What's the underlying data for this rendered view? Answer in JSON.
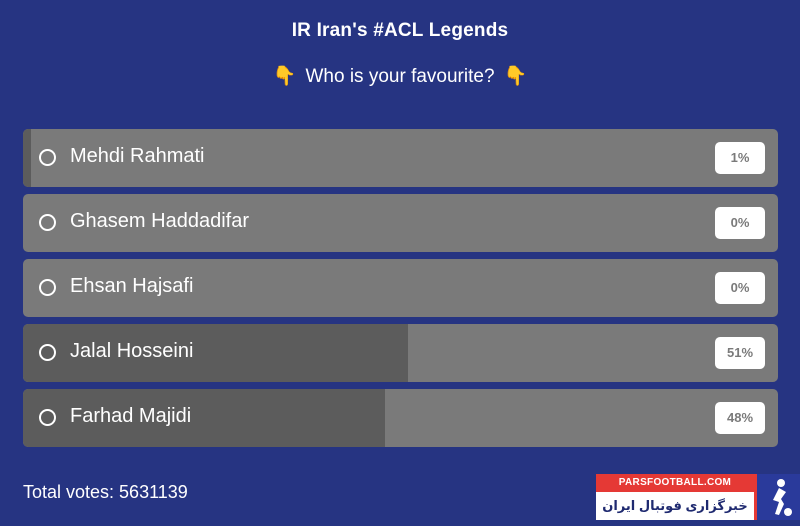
{
  "poll": {
    "title": "IR Iran's #ACL Legends",
    "question": "Who is your favourite?",
    "question_emoji": "👇",
    "options": [
      {
        "label": "Mehdi Rahmati",
        "percent_label": "1%",
        "percent": 1
      },
      {
        "label": "Ghasem Haddadifar",
        "percent_label": "0%",
        "percent": 0
      },
      {
        "label": "Ehsan Hajsafi",
        "percent_label": "0%",
        "percent": 0
      },
      {
        "label": "Jalal Hosseini",
        "percent_label": "51%",
        "percent": 51
      },
      {
        "label": "Farhad Majidi",
        "percent_label": "48%",
        "percent": 48
      }
    ],
    "total_votes_text": "Total votes: 5631139"
  },
  "watermark": {
    "latin": "PARSFOOTBALL.COM",
    "persian": "خبرگزاری فوتبال ایران"
  },
  "colors": {
    "background": "#263482",
    "option_bar": "#7a7a7a",
    "option_fill": "#5c5c5c",
    "brand_red": "#e53935"
  }
}
